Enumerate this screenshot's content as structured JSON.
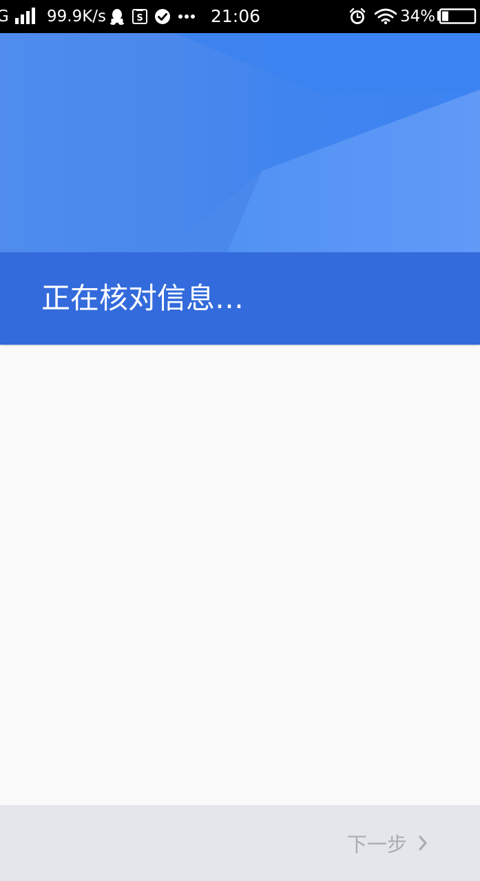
{
  "status_bar": {
    "network_type": "G",
    "speed": "99.9K/s",
    "time": "21:06",
    "battery": "34%",
    "battery_level": 0.34,
    "icons": [
      "signal-icon",
      "qq-icon",
      "s-app-icon",
      "check-circle-icon",
      "more-dots-icon",
      "alarm-icon",
      "wifi-icon",
      "battery-icon"
    ]
  },
  "header": {
    "title": "正在核对信息…",
    "colors": {
      "hero": "#4a88ec",
      "band": "#336bdc"
    }
  },
  "footer": {
    "next_label": "下一步",
    "next_icon": "chevron-right-icon",
    "enabled": false
  }
}
